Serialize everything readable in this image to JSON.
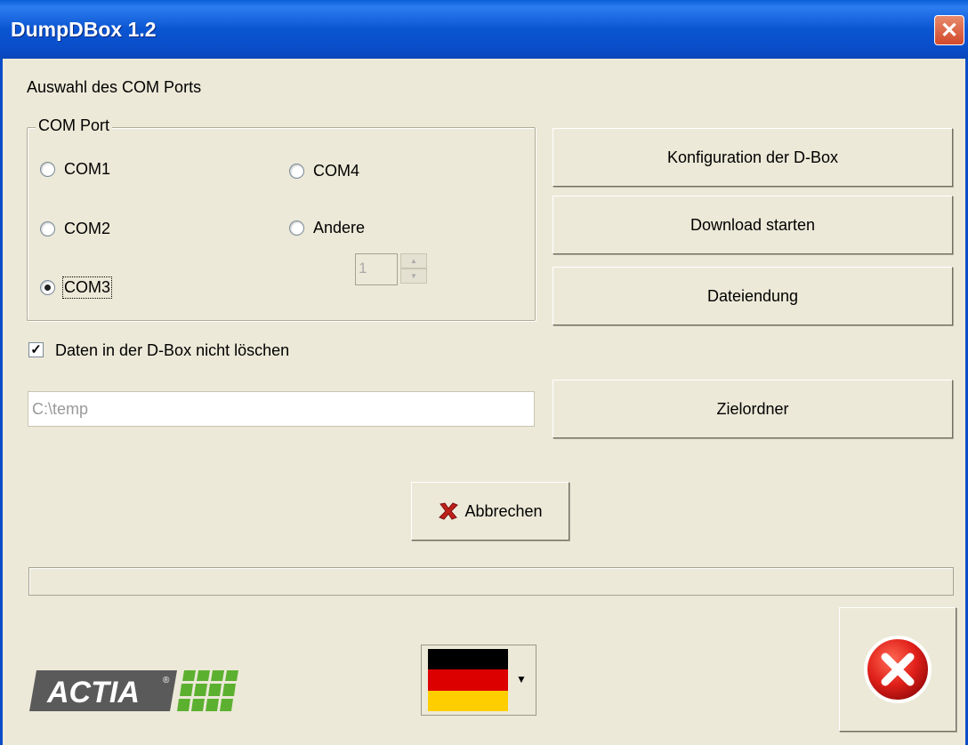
{
  "window": {
    "title": "DumpDBox 1.2",
    "close_glyph": "✕"
  },
  "section_label": "Auswahl des COM Ports",
  "com_group": {
    "legend": "COM Port",
    "options": [
      {
        "label": "COM1",
        "checked": false
      },
      {
        "label": "COM2",
        "checked": false
      },
      {
        "label": "COM3",
        "checked": true
      },
      {
        "label": "COM4",
        "checked": false
      },
      {
        "label": "Andere",
        "checked": false
      }
    ],
    "other_port_value": "1"
  },
  "buttons": {
    "config": "Konfiguration der D-Box",
    "download": "Download starten",
    "extension": "Dateiendung",
    "target_folder": "Zielordner",
    "cancel": "Abbrechen"
  },
  "checkbox": {
    "label": "Daten in der D-Box nicht löschen",
    "checked": true,
    "mark": "✓"
  },
  "path": {
    "value": "C:\\temp"
  },
  "progress": {
    "value": 0
  },
  "logo": {
    "text": "ACTIA"
  },
  "language": {
    "selected": "Deutsch",
    "arrow": "▼"
  },
  "icons": {
    "cancel": "x-mark-icon",
    "exit": "exit-icon"
  },
  "colors": {
    "title_bar": "#0a4cc8",
    "background": "#ece9d8",
    "cancel_red": "#c0201a"
  }
}
